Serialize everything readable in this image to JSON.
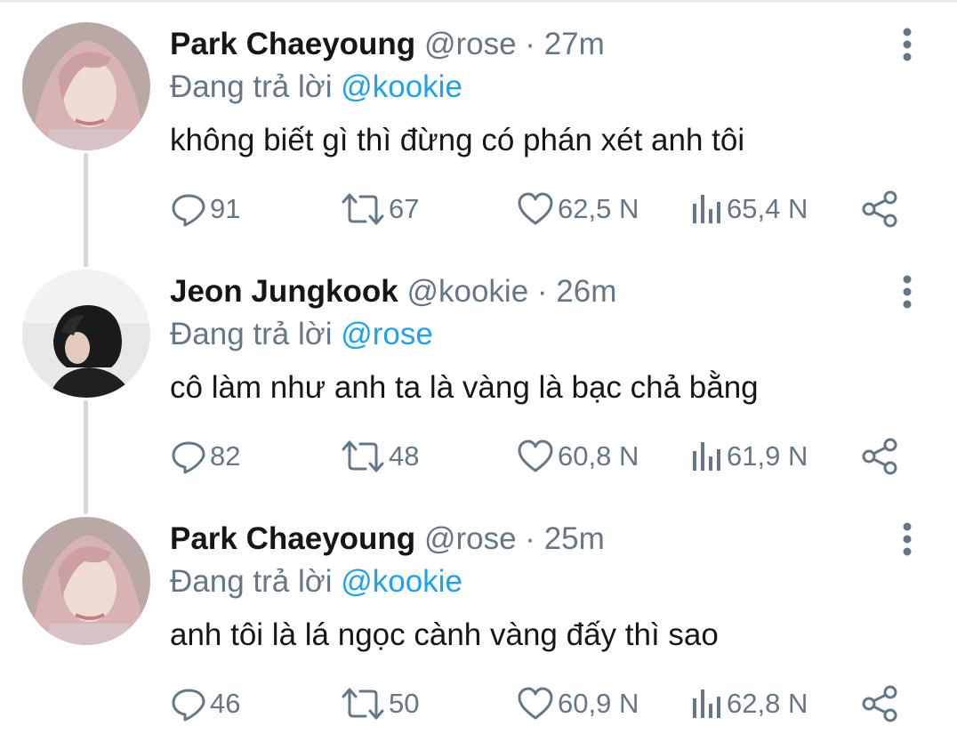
{
  "icons": {
    "reply": "reply-icon",
    "retweet": "retweet-icon",
    "like": "heart-icon",
    "views": "views-icon",
    "share": "share-icon",
    "more": "more-vertical-icon"
  },
  "colors": {
    "name": "#14171a",
    "secondary": "#657786",
    "mention": "#1da1f2",
    "thread_line": "#cfd9de"
  },
  "tweets": [
    {
      "name": "Park Chaeyoung",
      "handle": "@rose",
      "separator": "·",
      "time": "27m",
      "reply_prefix": "Đang trả lời",
      "reply_to": "@kookie",
      "text": "không biết gì thì đừng có phán xét anh tôi",
      "replies": "91",
      "retweets": "67",
      "likes": "62,5 N",
      "views": "65,4 N"
    },
    {
      "name": "Jeon Jungkook",
      "handle": "@kookie",
      "separator": "·",
      "time": "26m",
      "reply_prefix": "Đang trả lời",
      "reply_to": "@rose",
      "text": "cô làm như anh ta là vàng là bạc chả bằng",
      "replies": "82",
      "retweets": "48",
      "likes": "60,8 N",
      "views": "61,9 N"
    },
    {
      "name": "Park Chaeyoung",
      "handle": "@rose",
      "separator": "·",
      "time": "25m",
      "reply_prefix": "Đang trả lời",
      "reply_to": "@kookie",
      "text": "anh tôi là lá ngọc cành vàng đấy thì sao",
      "replies": "46",
      "retweets": "50",
      "likes": "60,9 N",
      "views": "62,8 N"
    }
  ]
}
